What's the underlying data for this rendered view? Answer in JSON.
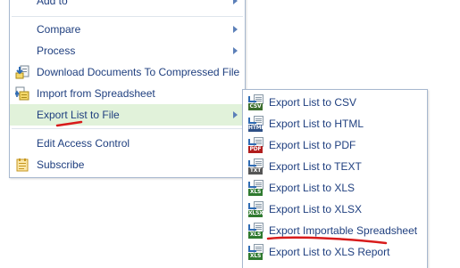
{
  "main_menu": {
    "items": [
      {
        "label": "Add to",
        "icon": "",
        "has_submenu": true
      },
      {
        "label": "Compare",
        "icon": "",
        "has_submenu": true
      },
      {
        "label": "Process",
        "icon": "",
        "has_submenu": true
      },
      {
        "label": "Download Documents To Compressed File",
        "icon": "download-compressed-icon",
        "has_submenu": false
      },
      {
        "label": "Import from Spreadsheet",
        "icon": "import-spreadsheet-icon",
        "has_submenu": false
      },
      {
        "label": "Export List to File",
        "icon": "",
        "has_submenu": true,
        "active": true
      },
      {
        "label": "Edit Access Control",
        "icon": "",
        "has_submenu": false
      },
      {
        "label": "Subscribe",
        "icon": "subscribe-icon",
        "has_submenu": false
      }
    ]
  },
  "export_submenu": {
    "items": [
      {
        "label": "Export List to CSV",
        "tag": "CSV",
        "tag_color": "#3a6d2c"
      },
      {
        "label": "Export List to HTML",
        "tag": "HTML",
        "tag_color": "#2d4f86"
      },
      {
        "label": "Export List to PDF",
        "tag": "PDF",
        "tag_color": "#b11d1d"
      },
      {
        "label": "Export List to TEXT",
        "tag": "TXT",
        "tag_color": "#555555"
      },
      {
        "label": "Export List to XLS",
        "tag": "XLS",
        "tag_color": "#2f7a2f"
      },
      {
        "label": "Export List to XLSX",
        "tag": "XLSX",
        "tag_color": "#2f7a2f"
      },
      {
        "label": "Export Importable Spreadsheet",
        "tag": "XLS",
        "tag_color": "#2f7a2f"
      },
      {
        "label": "Export List to XLS Report",
        "tag": "XLS",
        "tag_color": "#2f7a2f"
      }
    ]
  },
  "colors": {
    "text": "#1f3f7f",
    "active_background": "#e1f2da",
    "border": "#a7b8cf",
    "annotation": "#d81b1b"
  }
}
